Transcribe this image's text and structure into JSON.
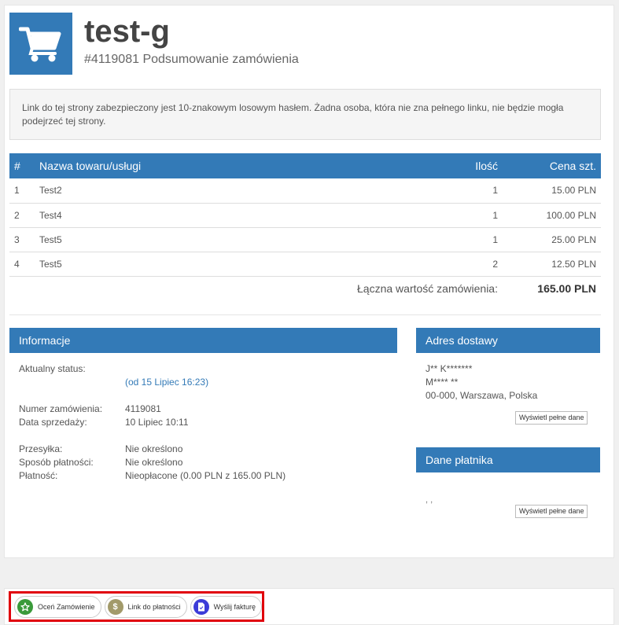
{
  "header": {
    "shop_name": "test-g",
    "subtitle": "#4119081 Podsumowanie zamówienia",
    "logo_icon": "shopping-cart-icon"
  },
  "notice": "Link do tej strony zabezpieczony jest 10-znakowym losowym hasłem. Żadna osoba, która nie zna pełnego linku, nie będzie mogła podejrzeć tej strony.",
  "items_table": {
    "headers": {
      "num": "#",
      "name": "Nazwa towaru/usługi",
      "qty": "Ilość",
      "price": "Cena szt."
    },
    "rows": [
      {
        "num": "1",
        "name": "Test2",
        "qty": "1",
        "price": "15.00 PLN"
      },
      {
        "num": "2",
        "name": "Test4",
        "qty": "1",
        "price": "100.00 PLN"
      },
      {
        "num": "3",
        "name": "Test5",
        "qty": "1",
        "price": "25.00 PLN"
      },
      {
        "num": "4",
        "name": "Test5",
        "qty": "2",
        "price": "12.50 PLN"
      }
    ],
    "total_label": "Łączna wartość zamówienia:",
    "total_value": "165.00 PLN"
  },
  "info": {
    "title": "Informacje",
    "status_label": "Aktualny status:",
    "status_date": "(od 15 Lipiec 16:23)",
    "order_number_label": "Numer zamówienia:",
    "order_number": "4119081",
    "sale_date_label": "Data sprzedaży:",
    "sale_date": "10 Lipiec 10:11",
    "shipping_label": "Przesyłka:",
    "shipping": "Nie określono",
    "payment_method_label": "Sposób płatności:",
    "payment_method": "Nie określono",
    "payment_label": "Płatność:",
    "payment": "Nieopłacone (0.00 PLN z 165.00 PLN)"
  },
  "delivery": {
    "title": "Adres dostawy",
    "line1": "J** K*******",
    "line2": "M**** **",
    "line3": "00-000, Warszawa, Polska",
    "show_full_button": "Wyświetl pełne dane"
  },
  "payer": {
    "title": "Dane płatnika",
    "line1": ", ,",
    "show_full_button": "Wyświetl pełne dane"
  },
  "actions": {
    "rate": {
      "label": "Oceń Zamówienie",
      "icon": "star-icon",
      "color": "#3a9a3a"
    },
    "pay_link": {
      "label": "Link do płatności",
      "icon": "dollar-icon",
      "color": "#a29a6a"
    },
    "invoice": {
      "label": "Wyślij fakturę",
      "icon": "document-icon",
      "color": "#3b3bd8"
    }
  },
  "colors": {
    "accent": "#337ab7",
    "highlight_border": "#e0000b"
  }
}
